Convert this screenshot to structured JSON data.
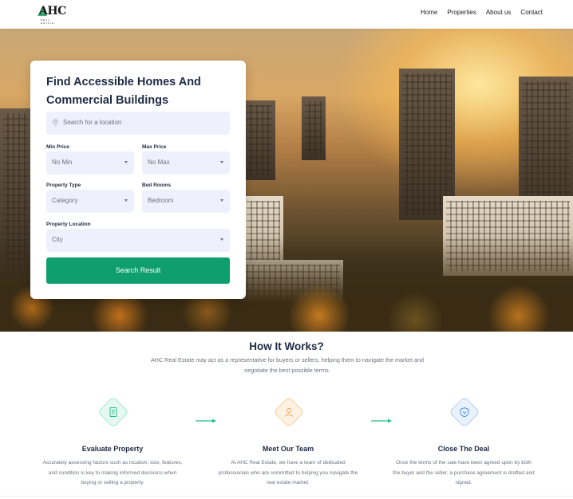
{
  "nav": {
    "logo_text": "AHC",
    "logo_tagline": "REAL ESTATE",
    "links": [
      "Home",
      "Properties",
      "About us",
      "Contact"
    ]
  },
  "search_card": {
    "title": "Find Accessible Homes And Commercial Buildings",
    "location_placeholder": "Search for a location",
    "min_price_label": "Min Price",
    "min_price_value": "No Min",
    "max_price_label": "Max Price",
    "max_price_value": "No Max",
    "property_type_label": "Property Type",
    "property_type_value": "Category",
    "bedrooms_label": "Bed Rooms",
    "bedrooms_value": "Bedroom",
    "location_label": "Property Location",
    "location_value": "City",
    "search_button": "Search Result"
  },
  "how_it_works": {
    "title": "How It Works?",
    "description": "AHC Real Estate may act as a representative for buyers or sellers, helping them to navigate the market and negotiate the best possible terms.",
    "steps": [
      {
        "title": "Evaluate Property",
        "text": "Accurately assessing factors such as location, size, features, and condition is key to making informed decisions when buying or selling a property.",
        "icon": "document-icon",
        "color": "#1dbf8a"
      },
      {
        "title": "Meet Our Team",
        "text": "At AHC Real Estate, we have a team of dedicated professionals who are committed to helping you navigate the real estate market.",
        "icon": "person-icon",
        "color": "#f0a04b"
      },
      {
        "title": "Close The Deal",
        "text": "Once the terms of the sale have been agreed upon by both the buyer and the seller, a purchase agreement is drafted and signed.",
        "icon": "shield-icon",
        "color": "#4a90e2"
      }
    ]
  },
  "colors": {
    "accent": "#0f9e6e",
    "heading": "#1e2a44",
    "field_bg": "#eef1fb"
  }
}
